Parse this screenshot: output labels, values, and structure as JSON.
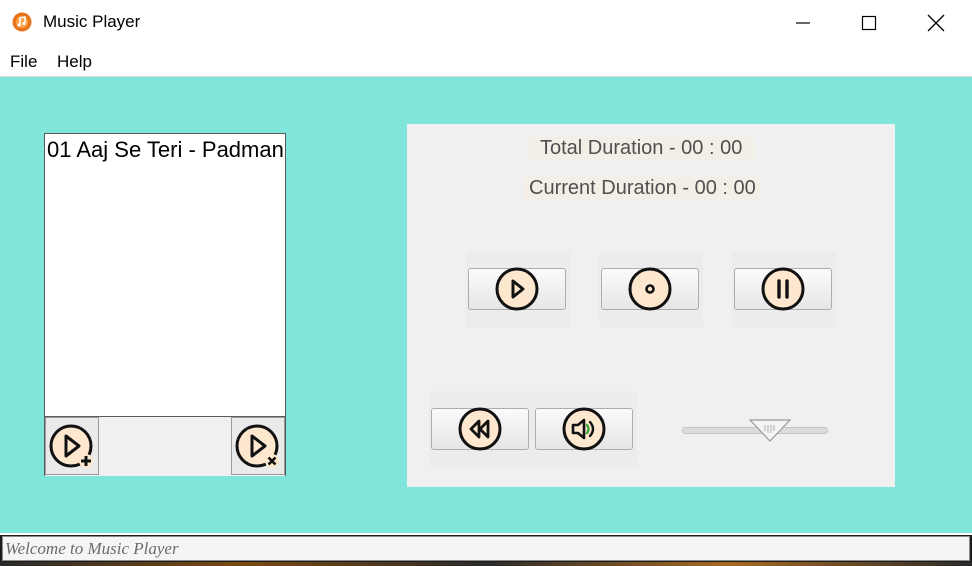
{
  "window": {
    "title": "Music Player",
    "icon": "music-note-icon"
  },
  "menu": {
    "file_label": "File",
    "help_label": "Help"
  },
  "playlist": {
    "items": [
      "01 Aaj Se Teri - Padman"
    ],
    "add_icon": "add-song-icon",
    "remove_icon": "remove-song-icon"
  },
  "player": {
    "total_duration": "Total Duration - 00 : 00",
    "current_duration": "Current Duration - 00 : 00",
    "buttons": {
      "play": "play-icon",
      "stop": "stop-icon",
      "pause": "pause-icon",
      "rewind": "rewind-icon",
      "volume": "volume-icon"
    },
    "volume_level": 0.6
  },
  "status": {
    "text": "Welcome to Music Player"
  },
  "colors": {
    "background": "#80e6dc",
    "panel": "#f0f0f0",
    "icon_fill": "#fde8cf",
    "volume_waves": "#3aa63a"
  }
}
